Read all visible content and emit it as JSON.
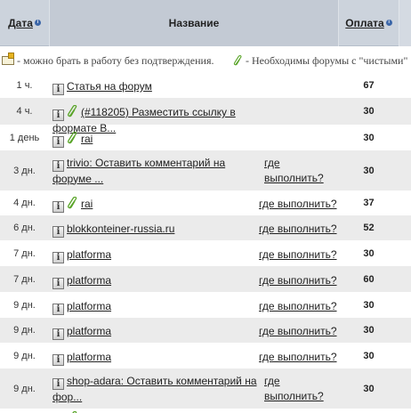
{
  "header": {
    "date_label": "Дата",
    "title_label": "Название",
    "payment_label": "Оплата",
    "info_glyph": "i"
  },
  "legend": {
    "no_confirm_text": "- можно брать в работу без подтверждения.",
    "clean_forums_text": "- Необходимы форумы с \"чистыми\""
  },
  "icons": {
    "info": "info-square-icon",
    "clip": "paperclip-icon",
    "legend_box": "no-confirm-icon"
  },
  "rows": [
    {
      "date": "1 ч.",
      "title": "Статья на форум",
      "where": "",
      "pay": "67",
      "clip": false,
      "h": 28,
      "alt": false
    },
    {
      "date": "4 ч.",
      "title": "(#118205) Разместить ссылку в формате В...",
      "where": "",
      "pay": "30",
      "clip": true,
      "h": 30,
      "alt": true
    },
    {
      "date": "1 день",
      "title": "rai",
      "where": "",
      "pay": "30",
      "clip": true,
      "h": 29,
      "alt": false
    },
    {
      "date": "3 дн.",
      "title_line1": "trivio: Оставить комментарий на",
      "title_line2": "форуме ...",
      "where_line1": "где",
      "where_line2": "выполнить?",
      "pay": "30",
      "clip": false,
      "h": 45,
      "alt": true,
      "two": true
    },
    {
      "date": "4 дн.",
      "title": "rai",
      "where": "где выполнить?",
      "pay": "37",
      "clip": true,
      "h": 28,
      "alt": false
    },
    {
      "date": "6 дн.",
      "title": "blokkonteiner-russia.ru",
      "where": "где выполнить?",
      "pay": "52",
      "clip": false,
      "h": 28,
      "alt": true
    },
    {
      "date": "7 дн.",
      "title": "platforma",
      "where": "где выполнить?",
      "pay": "30",
      "clip": false,
      "h": 29,
      "alt": false
    },
    {
      "date": "7 дн.",
      "title": "platforma",
      "where": "где выполнить?",
      "pay": "60",
      "clip": false,
      "h": 29,
      "alt": true
    },
    {
      "date": "9 дн.",
      "title": "platforma",
      "where": "где выполнить?",
      "pay": "30",
      "clip": false,
      "h": 29,
      "alt": false
    },
    {
      "date": "9 дн.",
      "title": "platforma",
      "where": "где выполнить?",
      "pay": "30",
      "clip": false,
      "h": 28,
      "alt": true
    },
    {
      "date": "9 дн.",
      "title": "platforma",
      "where": "где выполнить?",
      "pay": "30",
      "clip": false,
      "h": 29,
      "alt": false
    },
    {
      "date": "9 дн.",
      "title_line1": "shop-adara: Оставить комментарий на",
      "title_line2": "фор...",
      "where_line1": "где",
      "where_line2": "выполнить?",
      "pay": "30",
      "clip": false,
      "h": 45,
      "alt": true,
      "two": true
    },
    {
      "date": "",
      "title": "",
      "where": "",
      "pay": "",
      "clip": true,
      "h": 20,
      "alt": false
    }
  ]
}
